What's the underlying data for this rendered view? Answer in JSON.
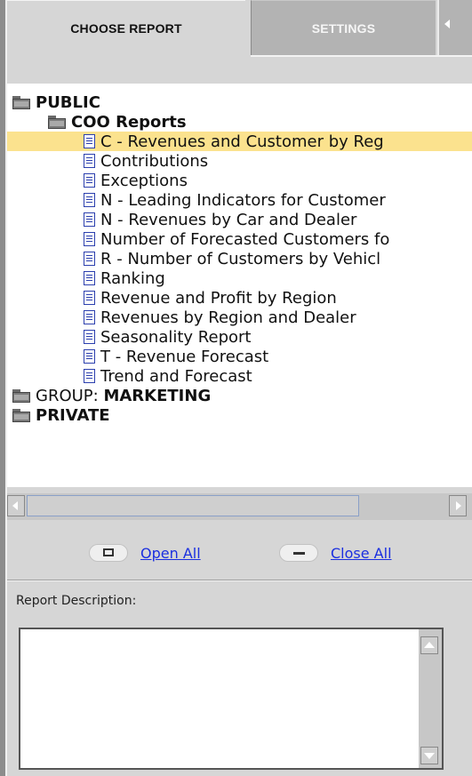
{
  "tabs": {
    "choose_report": "CHOOSE REPORT",
    "settings": "SETTINGS"
  },
  "tree": {
    "public": "PUBLIC",
    "coo_reports": "COO Reports",
    "reports": [
      "C - Revenues and Customer by Reg",
      "Contributions",
      "Exceptions",
      "N - Leading Indicators for Customer",
      "N - Revenues by Car and Dealer",
      "Number of Forecasted Customers fo",
      "R - Number of Customers by Vehicl",
      "Ranking",
      "Revenue and Profit by Region",
      "Revenues by Region and Dealer",
      "Seasonality Report",
      "T - Revenue Forecast",
      "Trend and Forecast"
    ],
    "group_prefix": "GROUP: ",
    "group_name": "MARKETING",
    "private": "PRIVATE"
  },
  "actions": {
    "open_all": "Open All",
    "close_all": "Close All"
  },
  "description": {
    "label": "Report Description:",
    "text": ""
  },
  "colors": {
    "selection": "#fbe28e",
    "link": "#1a2fe0",
    "doc_icon": "#2b3fae"
  }
}
